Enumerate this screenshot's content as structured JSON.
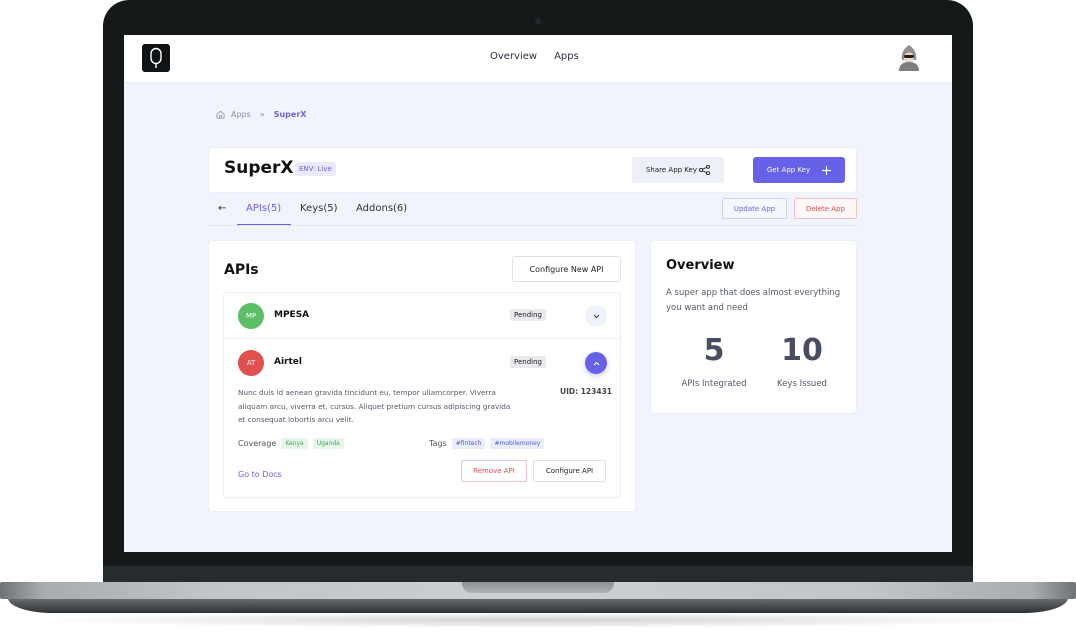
{
  "topbar": {
    "nav": [
      "Overview",
      "Apps"
    ]
  },
  "breadcrumb": {
    "root": "Apps",
    "separator": "»",
    "current": "SuperX"
  },
  "app": {
    "title": "SuperX",
    "env_badge": "ENV: Live",
    "share_label": "Share App Key",
    "get_key_label": "Get App Key",
    "accent_color": "#6661e6"
  },
  "tabs": {
    "back": "←",
    "items": [
      {
        "label": "APIs(5)",
        "active": true
      },
      {
        "label": "Keys(5)",
        "active": false
      },
      {
        "label": "Addons(6)",
        "active": false
      }
    ],
    "update_label": "Update App",
    "delete_label": "Delete App"
  },
  "apis": {
    "title": "APIs",
    "configure_new_label": "Configure New API",
    "list": [
      {
        "initials": "MP",
        "name": "MPESA",
        "status": "Pending",
        "color": "#5cbf68",
        "expanded": false
      },
      {
        "initials": "AT",
        "name": "Airtel",
        "status": "Pending",
        "color": "#e0504d",
        "expanded": true,
        "description": "Nunc duis id aenean gravida tincidunt eu, tempor ullamcorper. Viverra aliquam arcu, viverra et, cursus. Aliquet pretium cursus adipiscing gravida et consequat lobortis arcu velit.",
        "uid": "UID: 123431",
        "coverage_label": "Coverage",
        "coverage": [
          "Kenya",
          "Uganda"
        ],
        "tags_label": "Tags",
        "tags": [
          "#fintech",
          "#mobilemoney"
        ],
        "docs_label": "Go to Docs",
        "remove_label": "Remove API",
        "configure_label": "Configure API"
      }
    ]
  },
  "overview": {
    "title": "Overview",
    "description": "A super app that does almost everything you want and need",
    "stats": [
      {
        "value": "5",
        "label": "APIs Integrated"
      },
      {
        "value": "10",
        "label": "Keys Issued"
      }
    ]
  }
}
